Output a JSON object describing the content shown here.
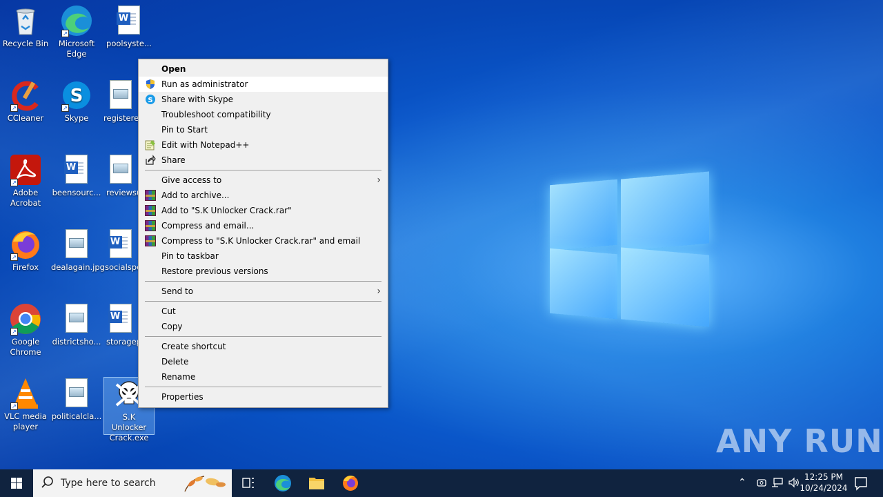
{
  "desktop": {
    "icons": [
      {
        "label": "Recycle Bin"
      },
      {
        "label": "Microsoft Edge"
      },
      {
        "label": "poolsyste..."
      },
      {
        "label": "CCleaner"
      },
      {
        "label": "Skype"
      },
      {
        "label": "registered"
      },
      {
        "label": "Adobe Acrobat"
      },
      {
        "label": "beensourc..."
      },
      {
        "label": "reviewsu"
      },
      {
        "label": "Firefox"
      },
      {
        "label": "dealagain.jpg"
      },
      {
        "label": "socialspe"
      },
      {
        "label": "Google Chrome"
      },
      {
        "label": "districtsho..."
      },
      {
        "label": "storagep"
      },
      {
        "label": "VLC media player"
      },
      {
        "label": "politicalcla..."
      },
      {
        "label": "S.K Unlocker Crack.exe"
      }
    ]
  },
  "context_menu": {
    "items": [
      {
        "label": "Open"
      },
      {
        "label": "Run as administrator"
      },
      {
        "label": "Share with Skype"
      },
      {
        "label": "Troubleshoot compatibility"
      },
      {
        "label": "Pin to Start"
      },
      {
        "label": "Edit with Notepad++"
      },
      {
        "label": "Share"
      },
      {
        "label": "Give access to"
      },
      {
        "label": "Add to archive..."
      },
      {
        "label": "Add to \"S.K Unlocker Crack.rar\""
      },
      {
        "label": "Compress and email..."
      },
      {
        "label": "Compress to \"S.K Unlocker Crack.rar\" and email"
      },
      {
        "label": "Pin to taskbar"
      },
      {
        "label": "Restore previous versions"
      },
      {
        "label": "Send to"
      },
      {
        "label": "Cut"
      },
      {
        "label": "Copy"
      },
      {
        "label": "Create shortcut"
      },
      {
        "label": "Delete"
      },
      {
        "label": "Rename"
      },
      {
        "label": "Properties"
      }
    ]
  },
  "watermark": {
    "text": "ANY RUN"
  },
  "taskbar": {
    "search_placeholder": "Type here to search",
    "time": "12:25 PM",
    "date": "10/24/2024"
  }
}
